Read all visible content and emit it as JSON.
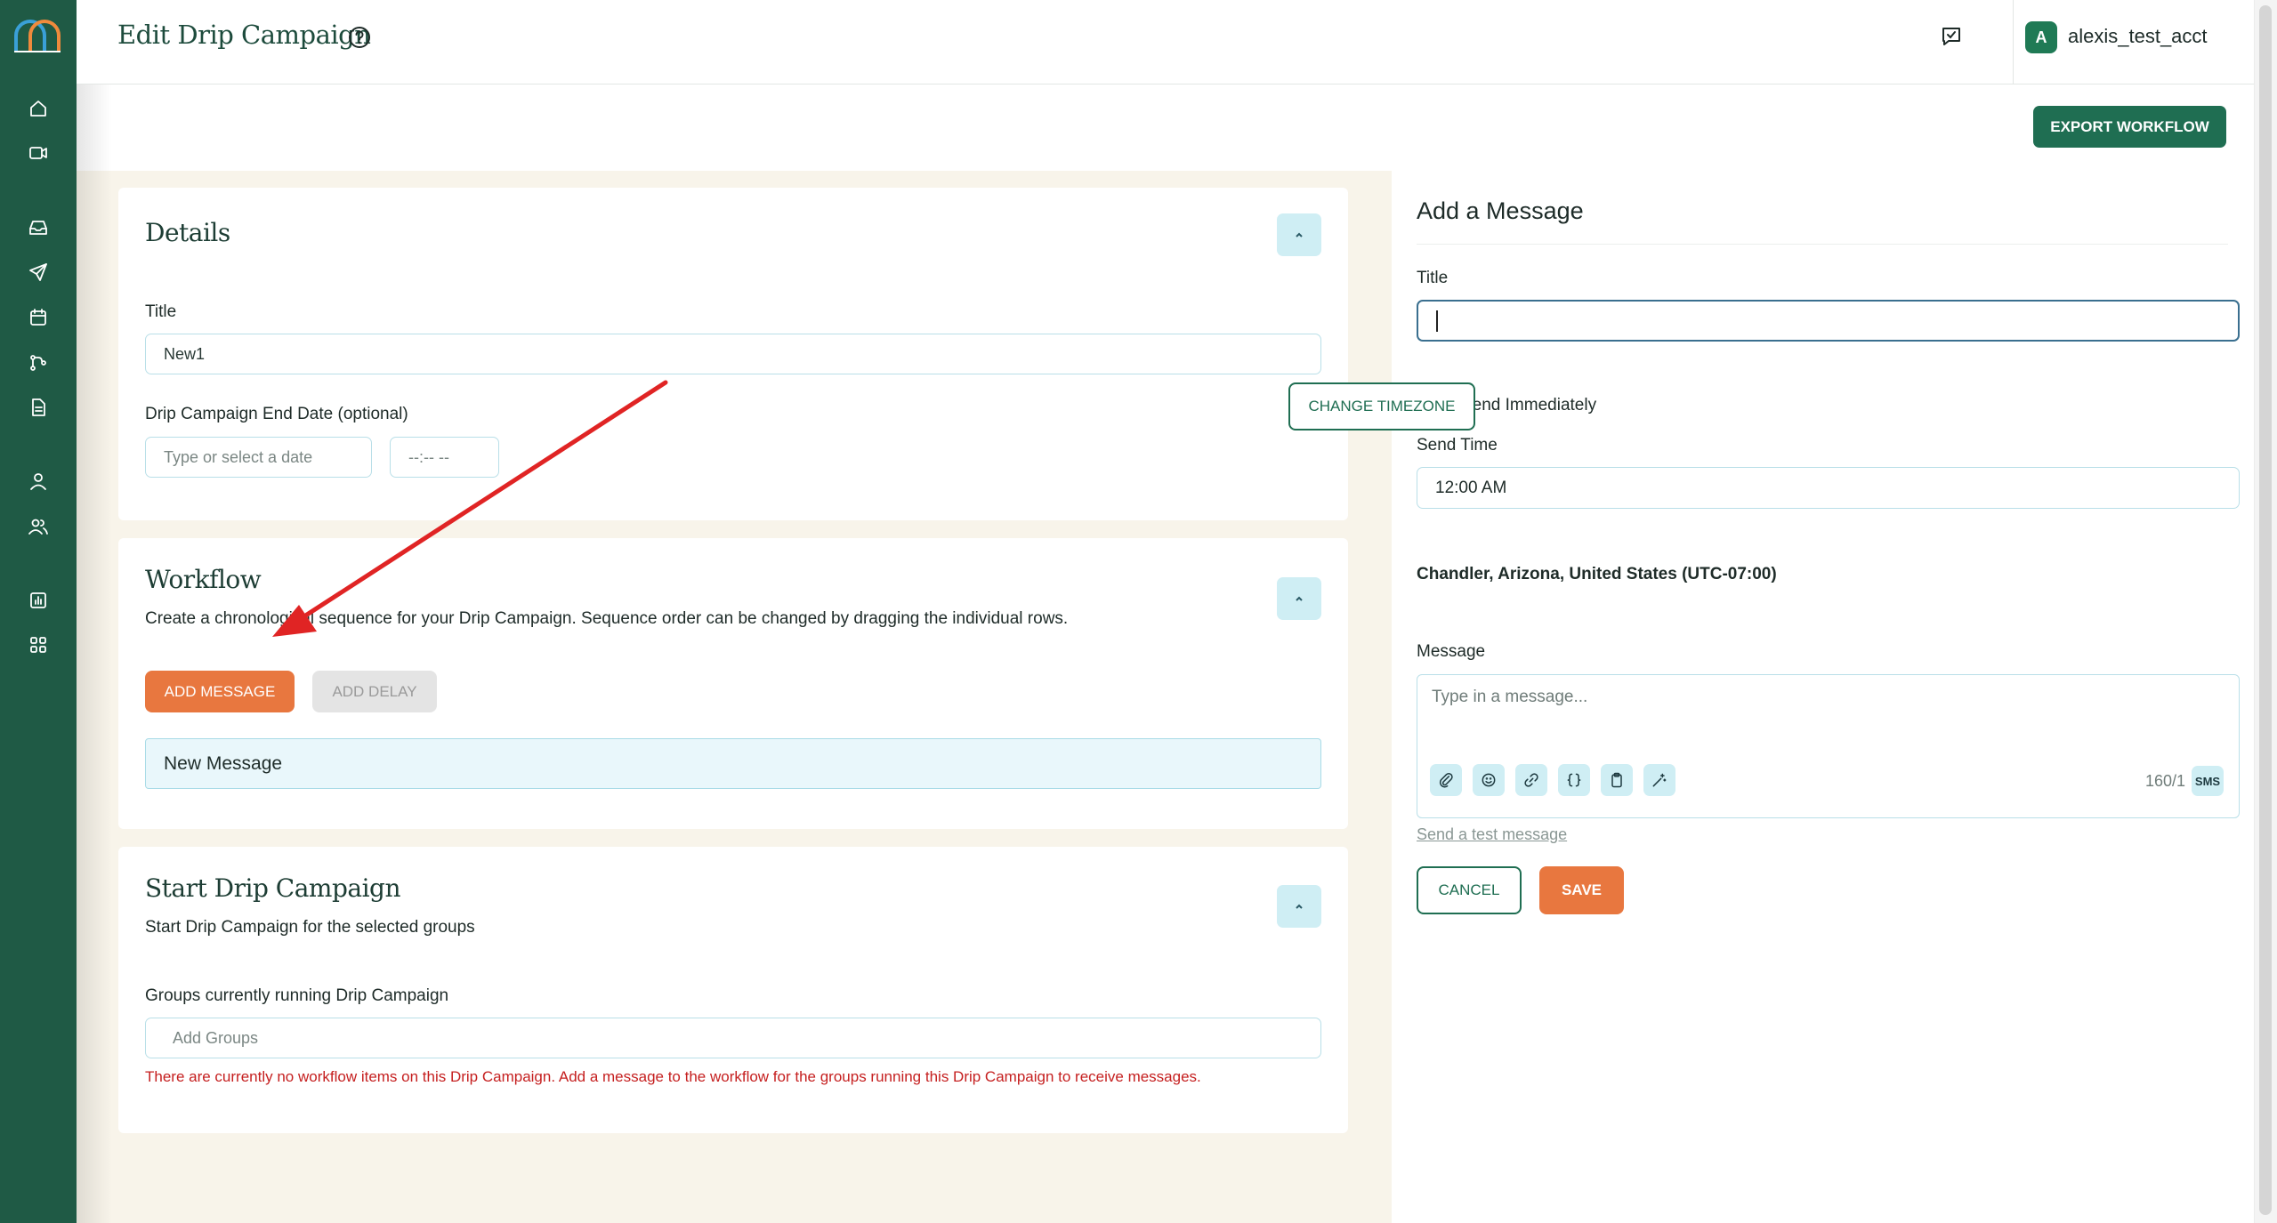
{
  "header": {
    "title": "Edit Drip Campaign",
    "account": {
      "initial": "A",
      "name": "alexis_test_acct"
    }
  },
  "toolbar": {
    "export_label": "EXPORT WORKFLOW"
  },
  "sidebar": {
    "items": [
      {
        "icon": "home-icon"
      },
      {
        "icon": "video-icon"
      },
      {
        "icon": "inbox-icon"
      },
      {
        "icon": "send-icon"
      },
      {
        "icon": "calendar-icon"
      },
      {
        "icon": "workflow-icon"
      },
      {
        "icon": "document-icon"
      },
      {
        "icon": "user-icon"
      },
      {
        "icon": "users-icon"
      },
      {
        "icon": "chart-icon"
      },
      {
        "icon": "apps-icon"
      }
    ]
  },
  "details": {
    "heading": "Details",
    "title_label": "Title",
    "title_value": "New1",
    "end_date_label": "Drip Campaign End Date (optional)",
    "date_placeholder": "Type or select a date",
    "time_placeholder": "--:-- --"
  },
  "workflow": {
    "heading": "Workflow",
    "description": "Create a chronological sequence for your Drip Campaign. Sequence order can be changed by dragging the individual rows.",
    "add_message_label": "ADD MESSAGE",
    "add_delay_label": "ADD DELAY",
    "rows": [
      "New Message"
    ]
  },
  "start": {
    "heading": "Start Drip Campaign",
    "description": "Start Drip Campaign for the selected groups",
    "groups_label": "Groups currently running Drip Campaign",
    "groups_placeholder": "Add Groups",
    "error": "There are currently no workflow items on this Drip Campaign. Add a message to the workflow for the groups running this Drip Campaign to receive messages."
  },
  "panel": {
    "heading": "Add a Message",
    "title_label": "Title",
    "title_value": "",
    "send_immediately_label": "Send Immediately",
    "send_immediately_checked": false,
    "send_time_label": "Send Time",
    "send_time_value": "12:00 AM",
    "timezone": "Chandler, Arizona, United States (UTC-07:00)",
    "change_timezone_label": "CHANGE TIMEZONE",
    "message_label": "Message",
    "message_placeholder": "Type in a message...",
    "char_count": "160/1",
    "channel": "SMS",
    "test_link": "Send a test message",
    "cancel_label": "CANCEL",
    "save_label": "SAVE"
  },
  "colors": {
    "brand_green": "#1f5a45",
    "accent_orange": "#e8773f",
    "error_red": "#c51f1f",
    "annotation_arrow": "#e02424"
  }
}
